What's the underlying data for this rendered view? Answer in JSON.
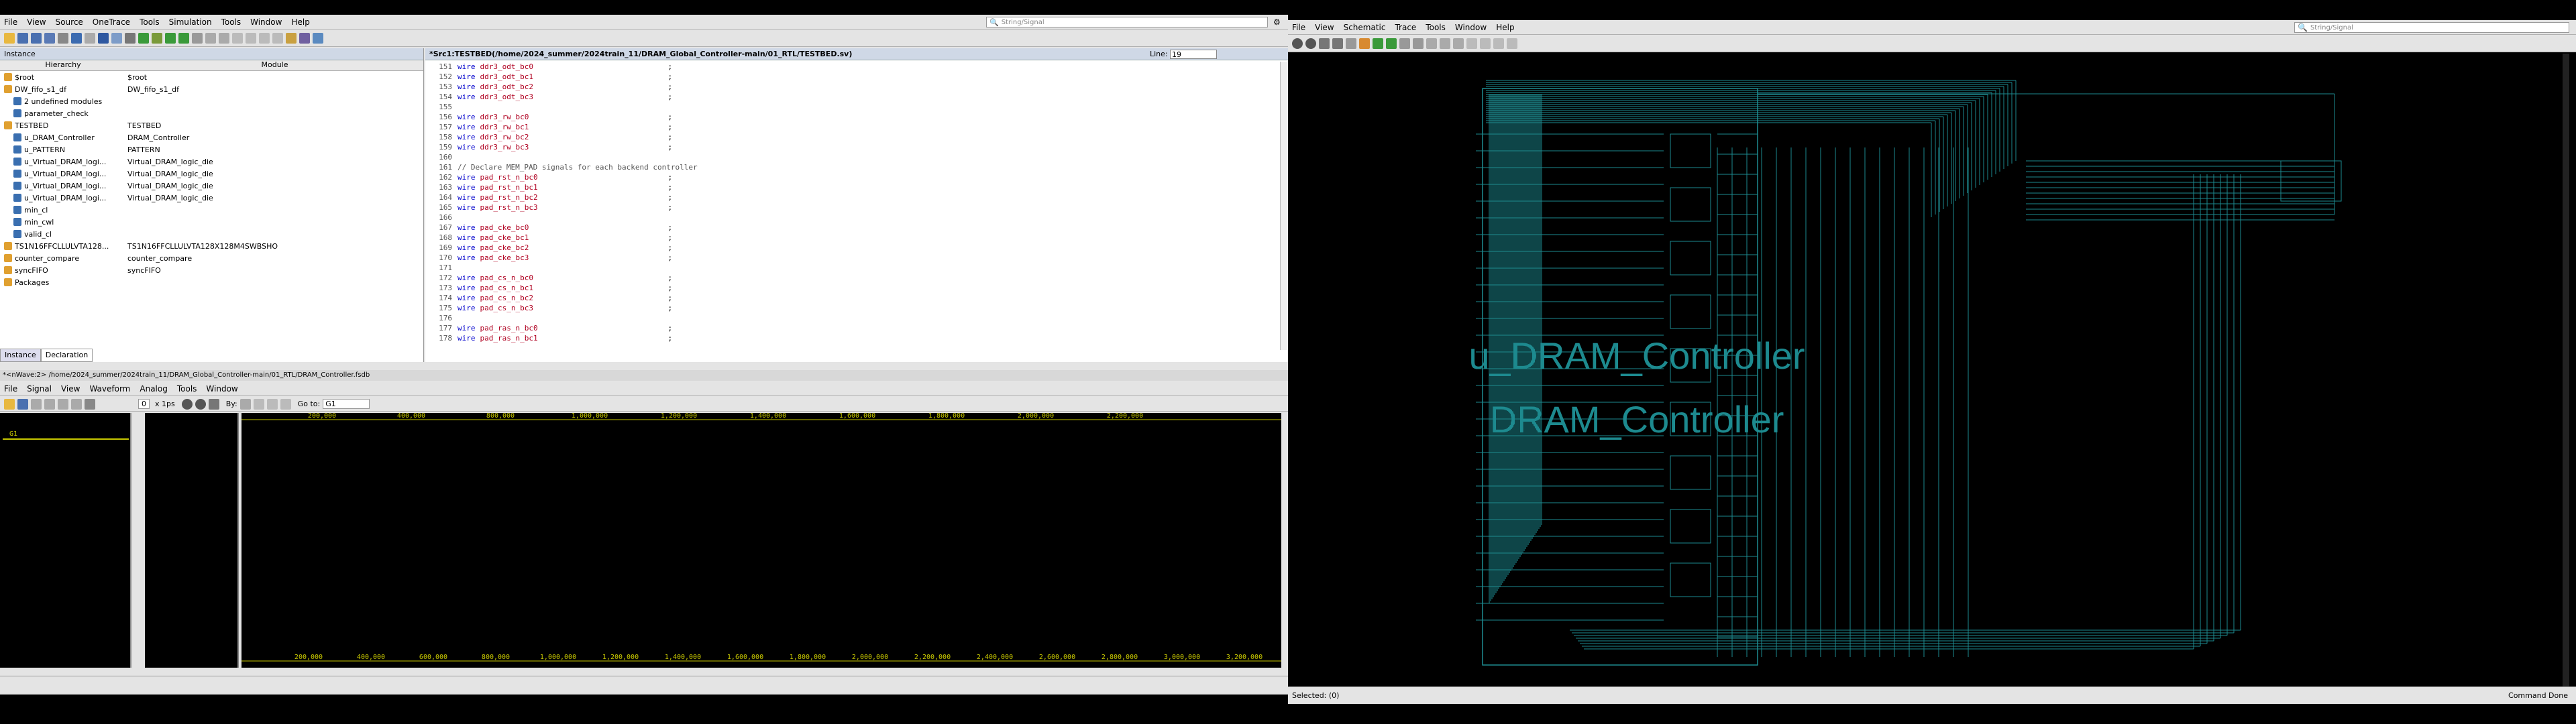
{
  "left_window": {
    "menu": [
      "File",
      "View",
      "Source",
      "OneTrace",
      "Tools",
      "Simulation",
      "Tools",
      "Window",
      "Help"
    ],
    "search_placeholder": "String/Signal",
    "instance_panel_title": "Instance",
    "columns": [
      "Hierarchy",
      "Module"
    ],
    "tree": [
      {
        "name": "$root",
        "module": "$root",
        "indent": 0
      },
      {
        "name": "DW_fifo_s1_df",
        "module": "DW_fifo_s1_df",
        "indent": 0
      },
      {
        "name": "2 undefined modules",
        "module": "",
        "indent": 1
      },
      {
        "name": "parameter_check",
        "module": "",
        "indent": 1
      },
      {
        "name": "TESTBED",
        "module": "TESTBED",
        "indent": 0
      },
      {
        "name": "u_DRAM_Controller",
        "module": "DRAM_Controller",
        "indent": 1
      },
      {
        "name": "u_PATTERN",
        "module": "PATTERN",
        "indent": 1
      },
      {
        "name": "u_Virtual_DRAM_logi...",
        "module": "Virtual_DRAM_logic_die",
        "indent": 1
      },
      {
        "name": "u_Virtual_DRAM_logi...",
        "module": "Virtual_DRAM_logic_die",
        "indent": 1
      },
      {
        "name": "u_Virtual_DRAM_logi...",
        "module": "Virtual_DRAM_logic_die",
        "indent": 1
      },
      {
        "name": "u_Virtual_DRAM_logi...",
        "module": "Virtual_DRAM_logic_die",
        "indent": 1
      },
      {
        "name": "min_cl",
        "module": "",
        "indent": 1
      },
      {
        "name": "min_cwl",
        "module": "",
        "indent": 1
      },
      {
        "name": "valid_cl",
        "module": "",
        "indent": 1
      },
      {
        "name": "TS1N16FFCLLULVTA128...",
        "module": "TS1N16FFCLLULVTA128X128M4SWBSHO",
        "indent": 0
      },
      {
        "name": "counter_compare",
        "module": "counter_compare",
        "indent": 0
      },
      {
        "name": "syncFIFO",
        "module": "syncFIFO",
        "indent": 0
      },
      {
        "name": "Packages",
        "module": "",
        "indent": 0
      }
    ],
    "bottom_tabs": [
      "Instance",
      "Declaration"
    ],
    "source_title": "*Src1:TESTBED(/home/2024_summer/2024train_11/DRAM_Global_Controller-main/01_RTL/TESTBED.sv)",
    "line_label": "Line:",
    "line_value": "19",
    "code_lines": [
      {
        "n": "151",
        "k": "wire",
        "id": "ddr3_odt_bc0",
        "t": ";"
      },
      {
        "n": "152",
        "k": "wire",
        "id": "ddr3_odt_bc1",
        "t": ";"
      },
      {
        "n": "153",
        "k": "wire",
        "id": "ddr3_odt_bc2",
        "t": ";"
      },
      {
        "n": "154",
        "k": "wire",
        "id": "ddr3_odt_bc3",
        "t": ";"
      },
      {
        "n": "155",
        "k": "",
        "id": "",
        "t": ""
      },
      {
        "n": "156",
        "k": "wire",
        "id": "ddr3_rw_bc0",
        "t": ";"
      },
      {
        "n": "157",
        "k": "wire",
        "id": "ddr3_rw_bc1",
        "t": ";"
      },
      {
        "n": "158",
        "k": "wire",
        "id": "ddr3_rw_bc2",
        "t": ";"
      },
      {
        "n": "159",
        "k": "wire",
        "id": "ddr3_rw_bc3",
        "t": ";"
      },
      {
        "n": "160",
        "k": "",
        "id": "",
        "t": ""
      },
      {
        "n": "161",
        "k": "",
        "id": "",
        "t": "// Declare MEM_PAD signals for each backend controller"
      },
      {
        "n": "162",
        "k": "wire",
        "id": "pad_rst_n_bc0",
        "t": ";"
      },
      {
        "n": "163",
        "k": "wire",
        "id": "pad_rst_n_bc1",
        "t": ";"
      },
      {
        "n": "164",
        "k": "wire",
        "id": "pad_rst_n_bc2",
        "t": ";"
      },
      {
        "n": "165",
        "k": "wire",
        "id": "pad_rst_n_bc3",
        "t": ";"
      },
      {
        "n": "166",
        "k": "",
        "id": "",
        "t": ""
      },
      {
        "n": "167",
        "k": "wire",
        "id": "pad_cke_bc0",
        "t": ";"
      },
      {
        "n": "168",
        "k": "wire",
        "id": "pad_cke_bc1",
        "t": ";"
      },
      {
        "n": "169",
        "k": "wire",
        "id": "pad_cke_bc2",
        "t": ";"
      },
      {
        "n": "170",
        "k": "wire",
        "id": "pad_cke_bc3",
        "t": ";"
      },
      {
        "n": "171",
        "k": "",
        "id": "",
        "t": ""
      },
      {
        "n": "172",
        "k": "wire",
        "id": "pad_cs_n_bc0",
        "t": ";"
      },
      {
        "n": "173",
        "k": "wire",
        "id": "pad_cs_n_bc1",
        "t": ";"
      },
      {
        "n": "174",
        "k": "wire",
        "id": "pad_cs_n_bc2",
        "t": ";"
      },
      {
        "n": "175",
        "k": "wire",
        "id": "pad_cs_n_bc3",
        "t": ";"
      },
      {
        "n": "176",
        "k": "",
        "id": "",
        "t": ""
      },
      {
        "n": "177",
        "k": "wire",
        "id": "pad_ras_n_bc0",
        "t": ";"
      },
      {
        "n": "178",
        "k": "wire",
        "id": "pad_ras_n_bc1",
        "t": ";"
      }
    ],
    "wave_title": "*<nWave:2> /home/2024_summer/2024train_11/DRAM_Global_Controller-main/01_RTL/DRAM_Controller.fsdb",
    "wave_menu": [
      "File",
      "Signal",
      "View",
      "Waveform",
      "Analog",
      "Tools",
      "Window"
    ],
    "time_unit": "x 1ps",
    "by_label": "By:",
    "goto_label": "Go to:",
    "goto_value": "G1",
    "signal_group": "G1",
    "stepper_value": "0",
    "ticks": [
      "200,000",
      "400,000",
      "600,000",
      "800,000",
      "1,000,000",
      "1,200,000",
      "1,400,000",
      "1,600,000",
      "1,800,000",
      "2,000,000",
      "2,200,000",
      "2,400,000",
      "2,600,000",
      "2,800,000",
      "3,000,000",
      "3,200,000"
    ],
    "top_ruler_ticks": [
      "200,000",
      "400,000",
      "800,000",
      "1,000,000",
      "1,200,000",
      "1,400,000",
      "1,600,000",
      "1,800,000",
      "2,000,000",
      "2,200,000"
    ]
  },
  "right_window": {
    "menu": [
      "File",
      "View",
      "Schematic",
      "Trace",
      "Tools",
      "Window",
      "Help"
    ],
    "search_placeholder": "String/Signal",
    "instance_label": "u_DRAM_Controller",
    "module_label": "DRAM_Controller",
    "status_left": "Selected: (0)",
    "status_right": "Command Done"
  },
  "colors": {
    "teal": "#1d8a8f",
    "yellow": "#c8c800",
    "bg": "#000000"
  }
}
